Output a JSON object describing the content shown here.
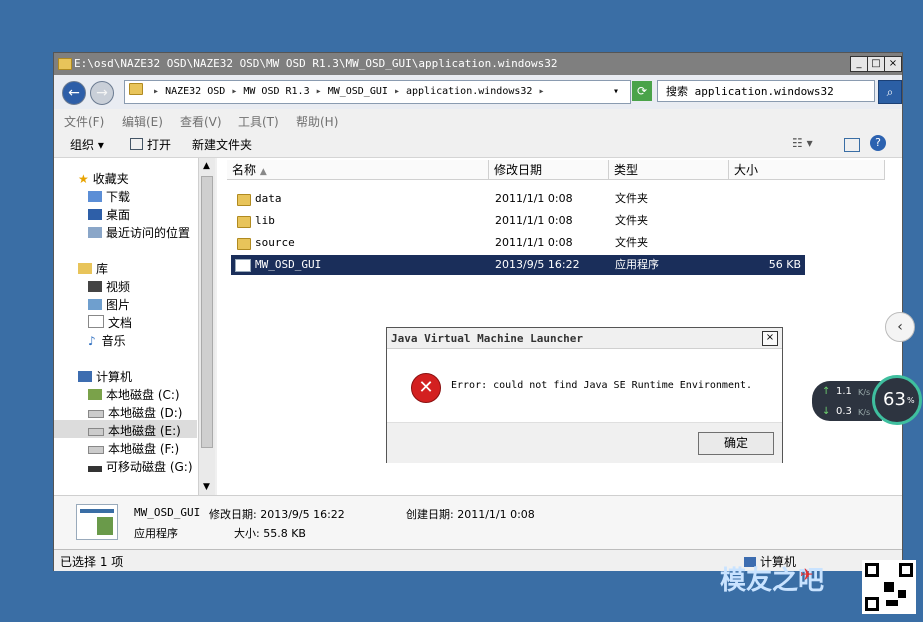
{
  "window": {
    "title": "E:\\osd\\NAZE32 OSD\\NAZE32 OSD\\MW OSD R1.3\\MW_OSD_GUI\\application.windows32",
    "caption_buttons": [
      "_",
      "□",
      "×"
    ]
  },
  "nav": {
    "back": "←",
    "forward": "→",
    "address_parts": [
      "NAZE32 OSD",
      "MW OSD R1.3",
      "MW_OSD_GUI",
      "application.windows32"
    ],
    "search_placeholder": "搜索 application.windows32"
  },
  "menu": [
    "文件(F)",
    "编辑(E)",
    "查看(V)",
    "工具(T)",
    "帮助(H)"
  ],
  "toolbar": {
    "organize": "组织",
    "open": "打开",
    "new_folder": "新建文件夹"
  },
  "sidebar": {
    "favorites": {
      "label": "收藏夹",
      "items": [
        "下载",
        "桌面",
        "最近访问的位置"
      ]
    },
    "library": {
      "label": "库",
      "items": [
        "视频",
        "图片",
        "文档",
        "音乐"
      ]
    },
    "computer": {
      "label": "计算机",
      "items": [
        "本地磁盘 (C:)",
        "本地磁盘 (D:)",
        "本地磁盘 (E:)",
        "本地磁盘 (F:)",
        "可移动磁盘 (G:)"
      ],
      "selected": "本地磁盘 (E:)"
    }
  },
  "columns": [
    "名称",
    "修改日期",
    "类型",
    "大小"
  ],
  "files": [
    {
      "name": "data",
      "date": "2011/1/1 0:08",
      "type": "文件夹",
      "size": ""
    },
    {
      "name": "lib",
      "date": "2011/1/1 0:08",
      "type": "文件夹",
      "size": ""
    },
    {
      "name": "source",
      "date": "2011/1/1 0:08",
      "type": "文件夹",
      "size": ""
    },
    {
      "name": "MW_OSD_GUI",
      "date": "2013/9/5 16:22",
      "type": "应用程序",
      "size": "56 KB"
    }
  ],
  "details": {
    "name": "MW_OSD_GUI",
    "modified": "修改日期: 2013/9/5 16:22",
    "created": "创建日期: 2011/1/1 0:08",
    "type": "应用程序",
    "size": "大小: 55.8 KB"
  },
  "status": {
    "selected": "已选择 1 项",
    "location": "计算机"
  },
  "dialog": {
    "title": "Java Virtual Machine Launcher",
    "message": "Error: could not find Java SE Runtime Environment.",
    "ok": "确定"
  },
  "netmeter": {
    "up": "1.1",
    "down": "0.3",
    "unit": "K/s",
    "percent": "63",
    "pct_sign": "%"
  },
  "watermark": "模友之吧",
  "colors": {
    "desktop": "#3a6ea5",
    "selection": "#1a2e5a",
    "error_red": "#d32020"
  }
}
